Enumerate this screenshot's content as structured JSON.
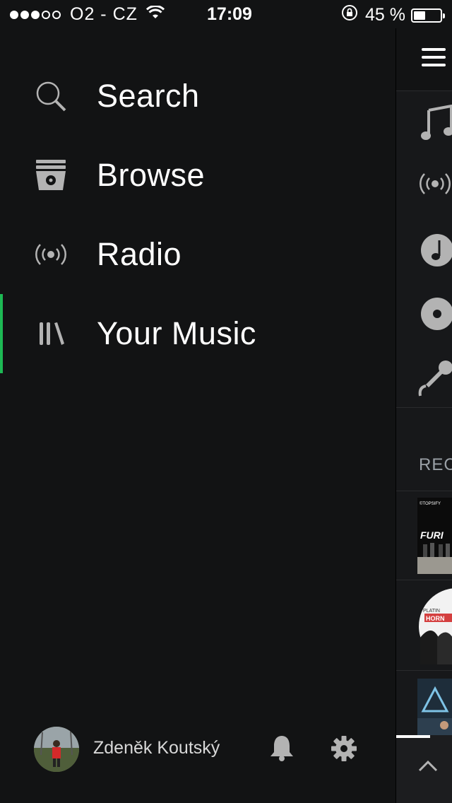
{
  "status_bar": {
    "carrier": "O2 - CZ",
    "time": "17:09",
    "battery": "45 %",
    "battery_level": 0.45,
    "signal_bars_filled": 3,
    "signal_bars_total": 5
  },
  "menu": {
    "items": [
      {
        "label": "Search",
        "icon": "search-icon"
      },
      {
        "label": "Browse",
        "icon": "browse-icon"
      },
      {
        "label": "Radio",
        "icon": "radio-icon"
      },
      {
        "label": "Your Music",
        "icon": "library-icon",
        "active": true
      }
    ]
  },
  "user": {
    "name": "Zdeněk Koutský"
  },
  "right_panel": {
    "section_label": "REC",
    "thumbs": [
      {
        "label": "FURI"
      },
      {
        "label": "HORN"
      },
      {
        "label": ""
      }
    ]
  },
  "colors": {
    "background": "#121314",
    "accent": "#1db954",
    "icon_gray": "#b3b3b3"
  }
}
